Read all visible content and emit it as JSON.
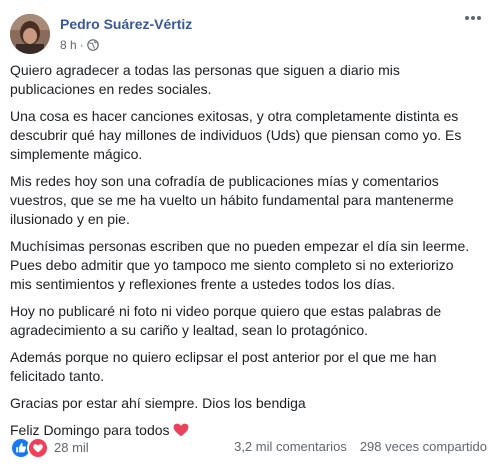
{
  "post": {
    "author": "Pedro Suárez-Vértiz",
    "time": "8 h",
    "separator": "·",
    "privacy_icon": "globe-icon",
    "more_icon": "more-options-icon",
    "paragraphs": [
      "Quiero agradecer a todas las personas que siguen a diario mis publicaciones en redes sociales.",
      "Una cosa es hacer canciones exitosas, y otra completamente distinta es descubrir qué hay millones de individuos (Uds) que piensan como yo. Es simplemente mágico.",
      "Mis redes hoy son una cofradía de publicaciones mías y comentarios vuestros, que se me ha vuelto un hábito fundamental para mantenerme ilusionado y en pie.",
      "Muchísimas personas escriben que no pueden empezar el día sin leerme. Pues debo admitir que yo tampoco me siento completo si no exteriorizo mis sentimientos y reflexiones frente a ustedes todos los días.",
      "Hoy no publicaré ni foto ni video porque quiero que estas palabras de agradecimiento a su cariño y lealtad, sean lo protagónico.",
      "Además porque no quiero eclipsar el post anterior por el que me han felicitado tanto.",
      "Gracias por estar ahí siempre. Dios los bendiga"
    ],
    "closing": "Feliz Domingo para todos",
    "closing_emoji": "heart-emoji",
    "reactions_count": "28 mil",
    "comments": "3,2 mil comentarios",
    "shares": "298 veces compartido"
  },
  "colors": {
    "author": "#385898",
    "meta": "#616770",
    "text": "#1c1e21",
    "like_blue": "#1877f2",
    "love_red": "#f33e58",
    "heart_emoji": "#e8435a"
  }
}
